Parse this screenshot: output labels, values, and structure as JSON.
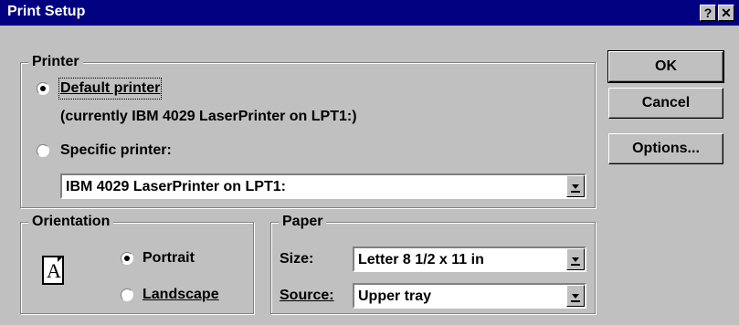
{
  "window": {
    "title": "Print Setup",
    "help_btn": "?",
    "close_btn": "✕"
  },
  "printer_group": {
    "legend": "Printer",
    "default_label": "Default printer",
    "default_note": "(currently IBM 4029 LaserPrinter on LPT1:)",
    "specific_label": "Specific printer:",
    "specific_value": "IBM 4029 LaserPrinter on LPT1:",
    "selected": "default"
  },
  "orientation_group": {
    "legend": "Orientation",
    "icon_letter": "A",
    "portrait_label": "Portrait",
    "landscape_label": "Landscape",
    "selected": "portrait"
  },
  "paper_group": {
    "legend": "Paper",
    "size_label": "Size:",
    "size_value": "Letter 8 1/2 x 11 in",
    "source_label": "Source:",
    "source_value": "Upper tray"
  },
  "buttons": {
    "ok": "OK",
    "cancel": "Cancel",
    "options": "Options..."
  }
}
